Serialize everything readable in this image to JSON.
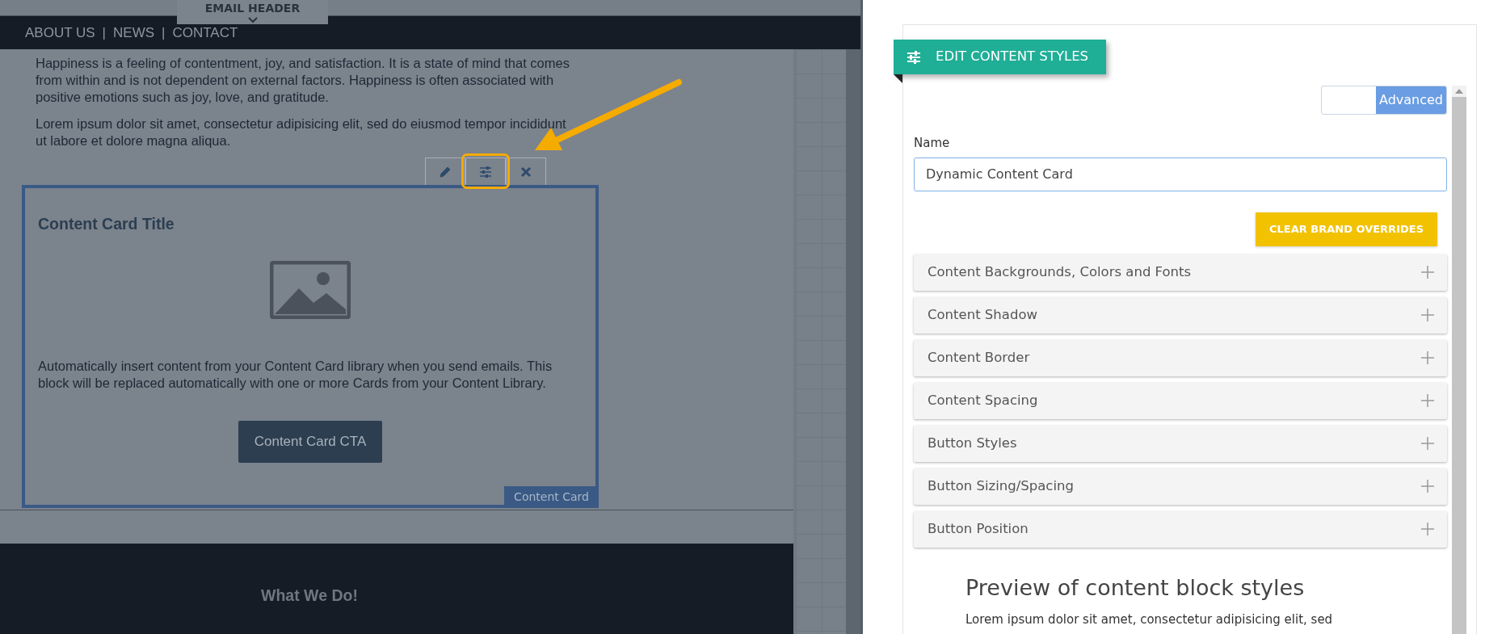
{
  "editor": {
    "header_tab": {
      "label": "EMAIL HEADER"
    },
    "nav": [
      "ABOUT US",
      "|",
      "NEWS",
      "|",
      "CONTACT"
    ],
    "paragraphs": [
      "Happiness is a feeling of contentment, joy, and satisfaction. It is a state of mind that comes from within and is not dependent on external factors. Happiness is often associated with positive emotions such as joy, love, and gratitude.",
      "Lorem ipsum dolor sit amet, consectetur adipisicing elit, sed do eiusmod tempor incididunt ut labore et dolore magna aliqua."
    ],
    "block_toolbar": [
      {
        "kind": "edit",
        "selected": false
      },
      {
        "kind": "styles",
        "selected": true
      },
      {
        "kind": "delete",
        "selected": false
      }
    ],
    "content_card": {
      "title": "Content Card Title",
      "body": "Automatically insert content from your Content Card library when you send emails. This block will be replaced automatically with one or more Cards from your Content Library.",
      "cta": "Content Card CTA",
      "tag": "Content Card"
    },
    "footer": {
      "heading": "What We Do!"
    }
  },
  "panel": {
    "title": "EDIT CONTENT STYLES",
    "mode_toggle": {
      "label": "Advanced",
      "on": true
    },
    "name_field": {
      "label": "Name",
      "value": "Dynamic Content Card"
    },
    "clear_button": "CLEAR BRAND OVERRIDES",
    "sections": [
      {
        "label": "Content Backgrounds, Colors and Fonts",
        "expanded": false
      },
      {
        "label": "Content Shadow",
        "expanded": false
      },
      {
        "label": "Content Border",
        "expanded": false
      },
      {
        "label": "Content Spacing",
        "expanded": false
      },
      {
        "label": "Button Styles",
        "expanded": false
      },
      {
        "label": "Button Sizing/Spacing",
        "expanded": false
      },
      {
        "label": "Button Position",
        "expanded": false
      }
    ],
    "preview": {
      "heading": "Preview of content block styles",
      "text": "Lorem ipsum dolor sit amet, consectetur adipisicing elit, sed"
    }
  }
}
